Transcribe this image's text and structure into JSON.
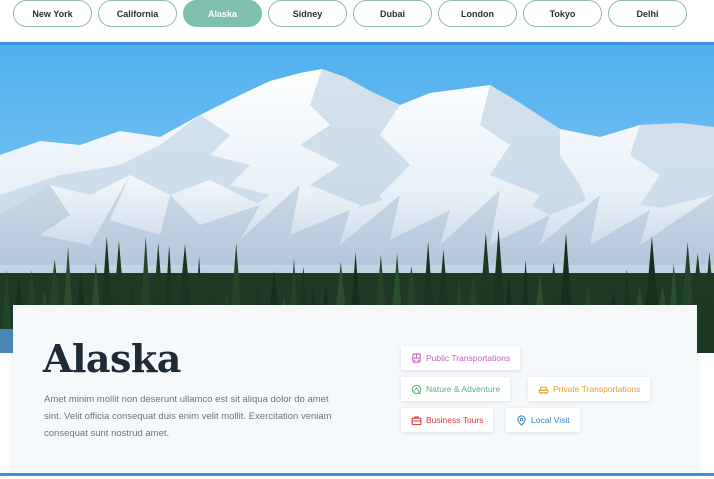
{
  "tabs": [
    {
      "label": "New York"
    },
    {
      "label": "California"
    },
    {
      "label": "Alaska",
      "active": true
    },
    {
      "label": "Sidney"
    },
    {
      "label": "Dubai"
    },
    {
      "label": "London"
    },
    {
      "label": "Tokyo"
    },
    {
      "label": "Delhi"
    }
  ],
  "hero": {
    "icon": "mountain-landscape-photo"
  },
  "card": {
    "title": "Alaska",
    "description": "Amet minim mollit non deserunt ullamco est sit aliqua dolor do amet sint. Velit officia consequat duis enim velit mollit. Exercitation veniam consequat sunt nostrud amet.",
    "tags": [
      {
        "label": "Public Transportations",
        "icon": "bus-icon",
        "color": "#c25bc4"
      },
      {
        "label": "Nature & Adventure",
        "icon": "nature-icon",
        "color": "#5fb07f"
      },
      {
        "label": "Private Transportations",
        "icon": "car-icon",
        "color": "#e0a323"
      },
      {
        "label": "Business Tours",
        "icon": "briefcase-icon",
        "color": "#d8383b"
      },
      {
        "label": "Local Visit",
        "icon": "map-pin-icon",
        "color": "#3b82c7"
      }
    ]
  },
  "colors": {
    "accent": "#7fbfae",
    "rule": "#3d8fe0"
  }
}
